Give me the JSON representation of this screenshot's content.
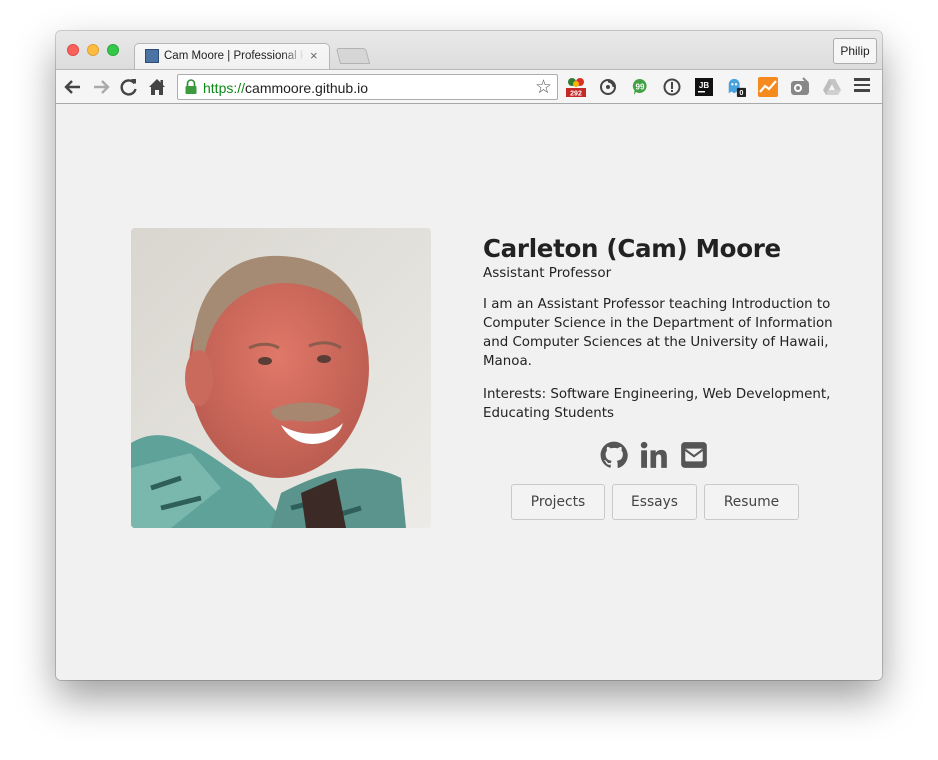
{
  "browser": {
    "tab_title": "Cam Moore | Professional Portfolio",
    "tab_close": "×",
    "profile_label": "Philip",
    "url_scheme": "https://",
    "url_host": "cammoore.github.io",
    "bookmark_star": "☆",
    "extensions": [
      {
        "name": "calendar-extension-icon",
        "badge": "292"
      },
      {
        "name": "sync-extension-icon"
      },
      {
        "name": "chat-extension-icon"
      },
      {
        "name": "info-extension-icon"
      },
      {
        "name": "jetbrains-extension-icon",
        "text": "JB"
      },
      {
        "name": "ghostery-extension-icon",
        "badge": "0"
      },
      {
        "name": "analytics-extension-icon"
      },
      {
        "name": "camera-extension-icon"
      },
      {
        "name": "drive-extension-icon"
      }
    ]
  },
  "profile": {
    "name": "Carleton (Cam) Moore",
    "title": "Assistant Professor",
    "bio": "I am an Assistant Professor teaching Introduction to Computer Science in the Department of Information and Computer Sciences at the University of Hawaii, Manoa.",
    "interests": "Interests: Software Engineering, Web Development, Educating Students",
    "social_icons": [
      "github-icon",
      "linkedin-icon",
      "email-icon"
    ]
  },
  "buttons": {
    "projects": "Projects",
    "essays": "Essays",
    "resume": "Resume"
  },
  "colors": {
    "page_background": "#f1f1f1",
    "text": "#222222",
    "secure_url": "#0b8a16"
  }
}
